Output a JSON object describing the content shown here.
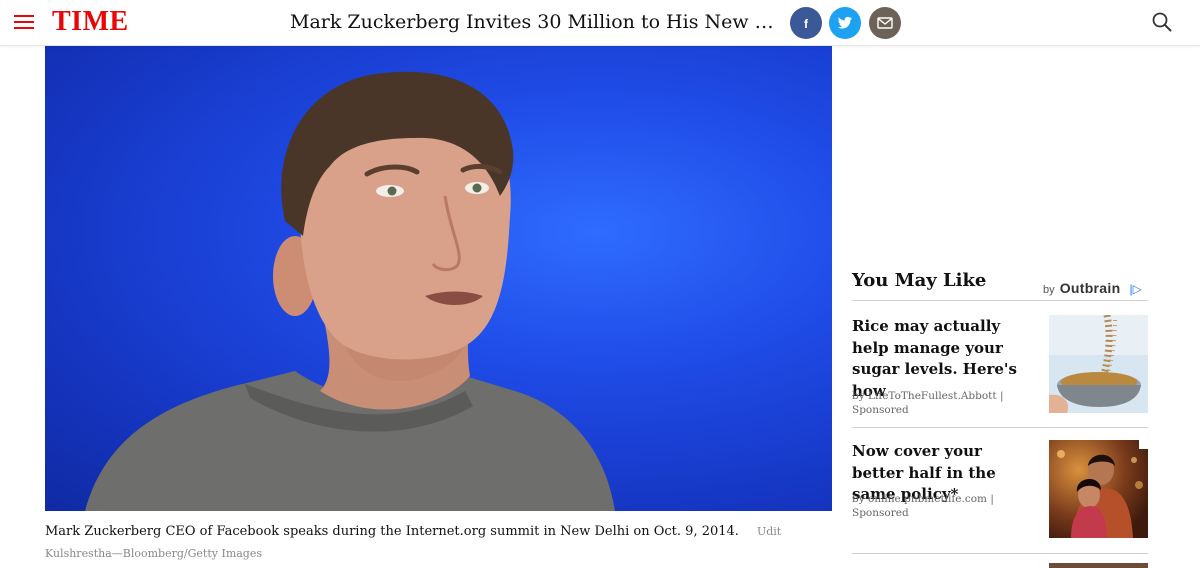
{
  "header": {
    "logo": "TIME",
    "headline": "Mark Zuckerberg Invites 30 Million to His New Book ...",
    "share_buttons": [
      {
        "name": "facebook",
        "icon": "facebook-icon",
        "color": "#3b5998"
      },
      {
        "name": "twitter",
        "icon": "twitter-icon",
        "color": "#1da1f2"
      },
      {
        "name": "email",
        "icon": "mail-icon",
        "color": "#6d6257"
      }
    ],
    "menu_icon": "hamburger-menu-icon",
    "search_icon": "search-icon",
    "brand_color": "#e90606"
  },
  "article": {
    "caption": "Mark Zuckerberg CEO of Facebook speaks during the Internet.org summit in New Delhi on Oct. 9, 2014.",
    "credit_part1": "Udit",
    "credit_part2": "Kulshrestha—Bloomberg/Getty Images"
  },
  "rail": {
    "title": "You May Like",
    "by_label": "by",
    "provider": "Outbrain",
    "provider_flag": "|▷",
    "items": [
      {
        "title": "Rice may actually help manage your sugar levels. Here's how",
        "source": "by LifeToTheFullest.Abbott |",
        "sponsored": "Sponsored",
        "thumbnail": "rice-sieve-image"
      },
      {
        "title": "Now cover your better half in the same policy*",
        "source": "by online.pnbmetlife.com |",
        "sponsored": "Sponsored",
        "thumbnail": "couple-photo-image"
      }
    ]
  }
}
